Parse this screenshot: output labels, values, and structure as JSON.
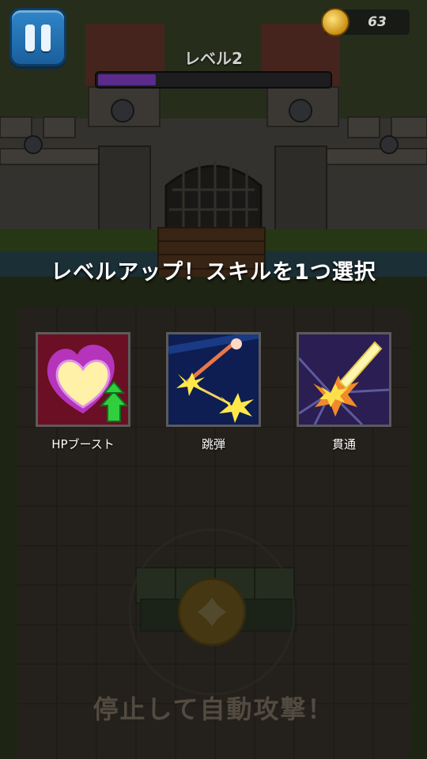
{
  "hud": {
    "level_label": "レベル2",
    "level_progress": 0.25,
    "coins": "63"
  },
  "overlay": {
    "title": "レベルアップ！スキルを1つ選択",
    "skills": [
      {
        "label": "HPブースト",
        "icon": "heart-boost-icon"
      },
      {
        "label": "跳弾",
        "icon": "ricochet-icon"
      },
      {
        "label": "貫通",
        "icon": "pierce-icon"
      }
    ]
  },
  "hint": "停止して自動攻撃！",
  "colors": {
    "xp_fill": "#5b2a8a",
    "pause_button": "#2f86c9",
    "coin": "#e0a81c"
  }
}
